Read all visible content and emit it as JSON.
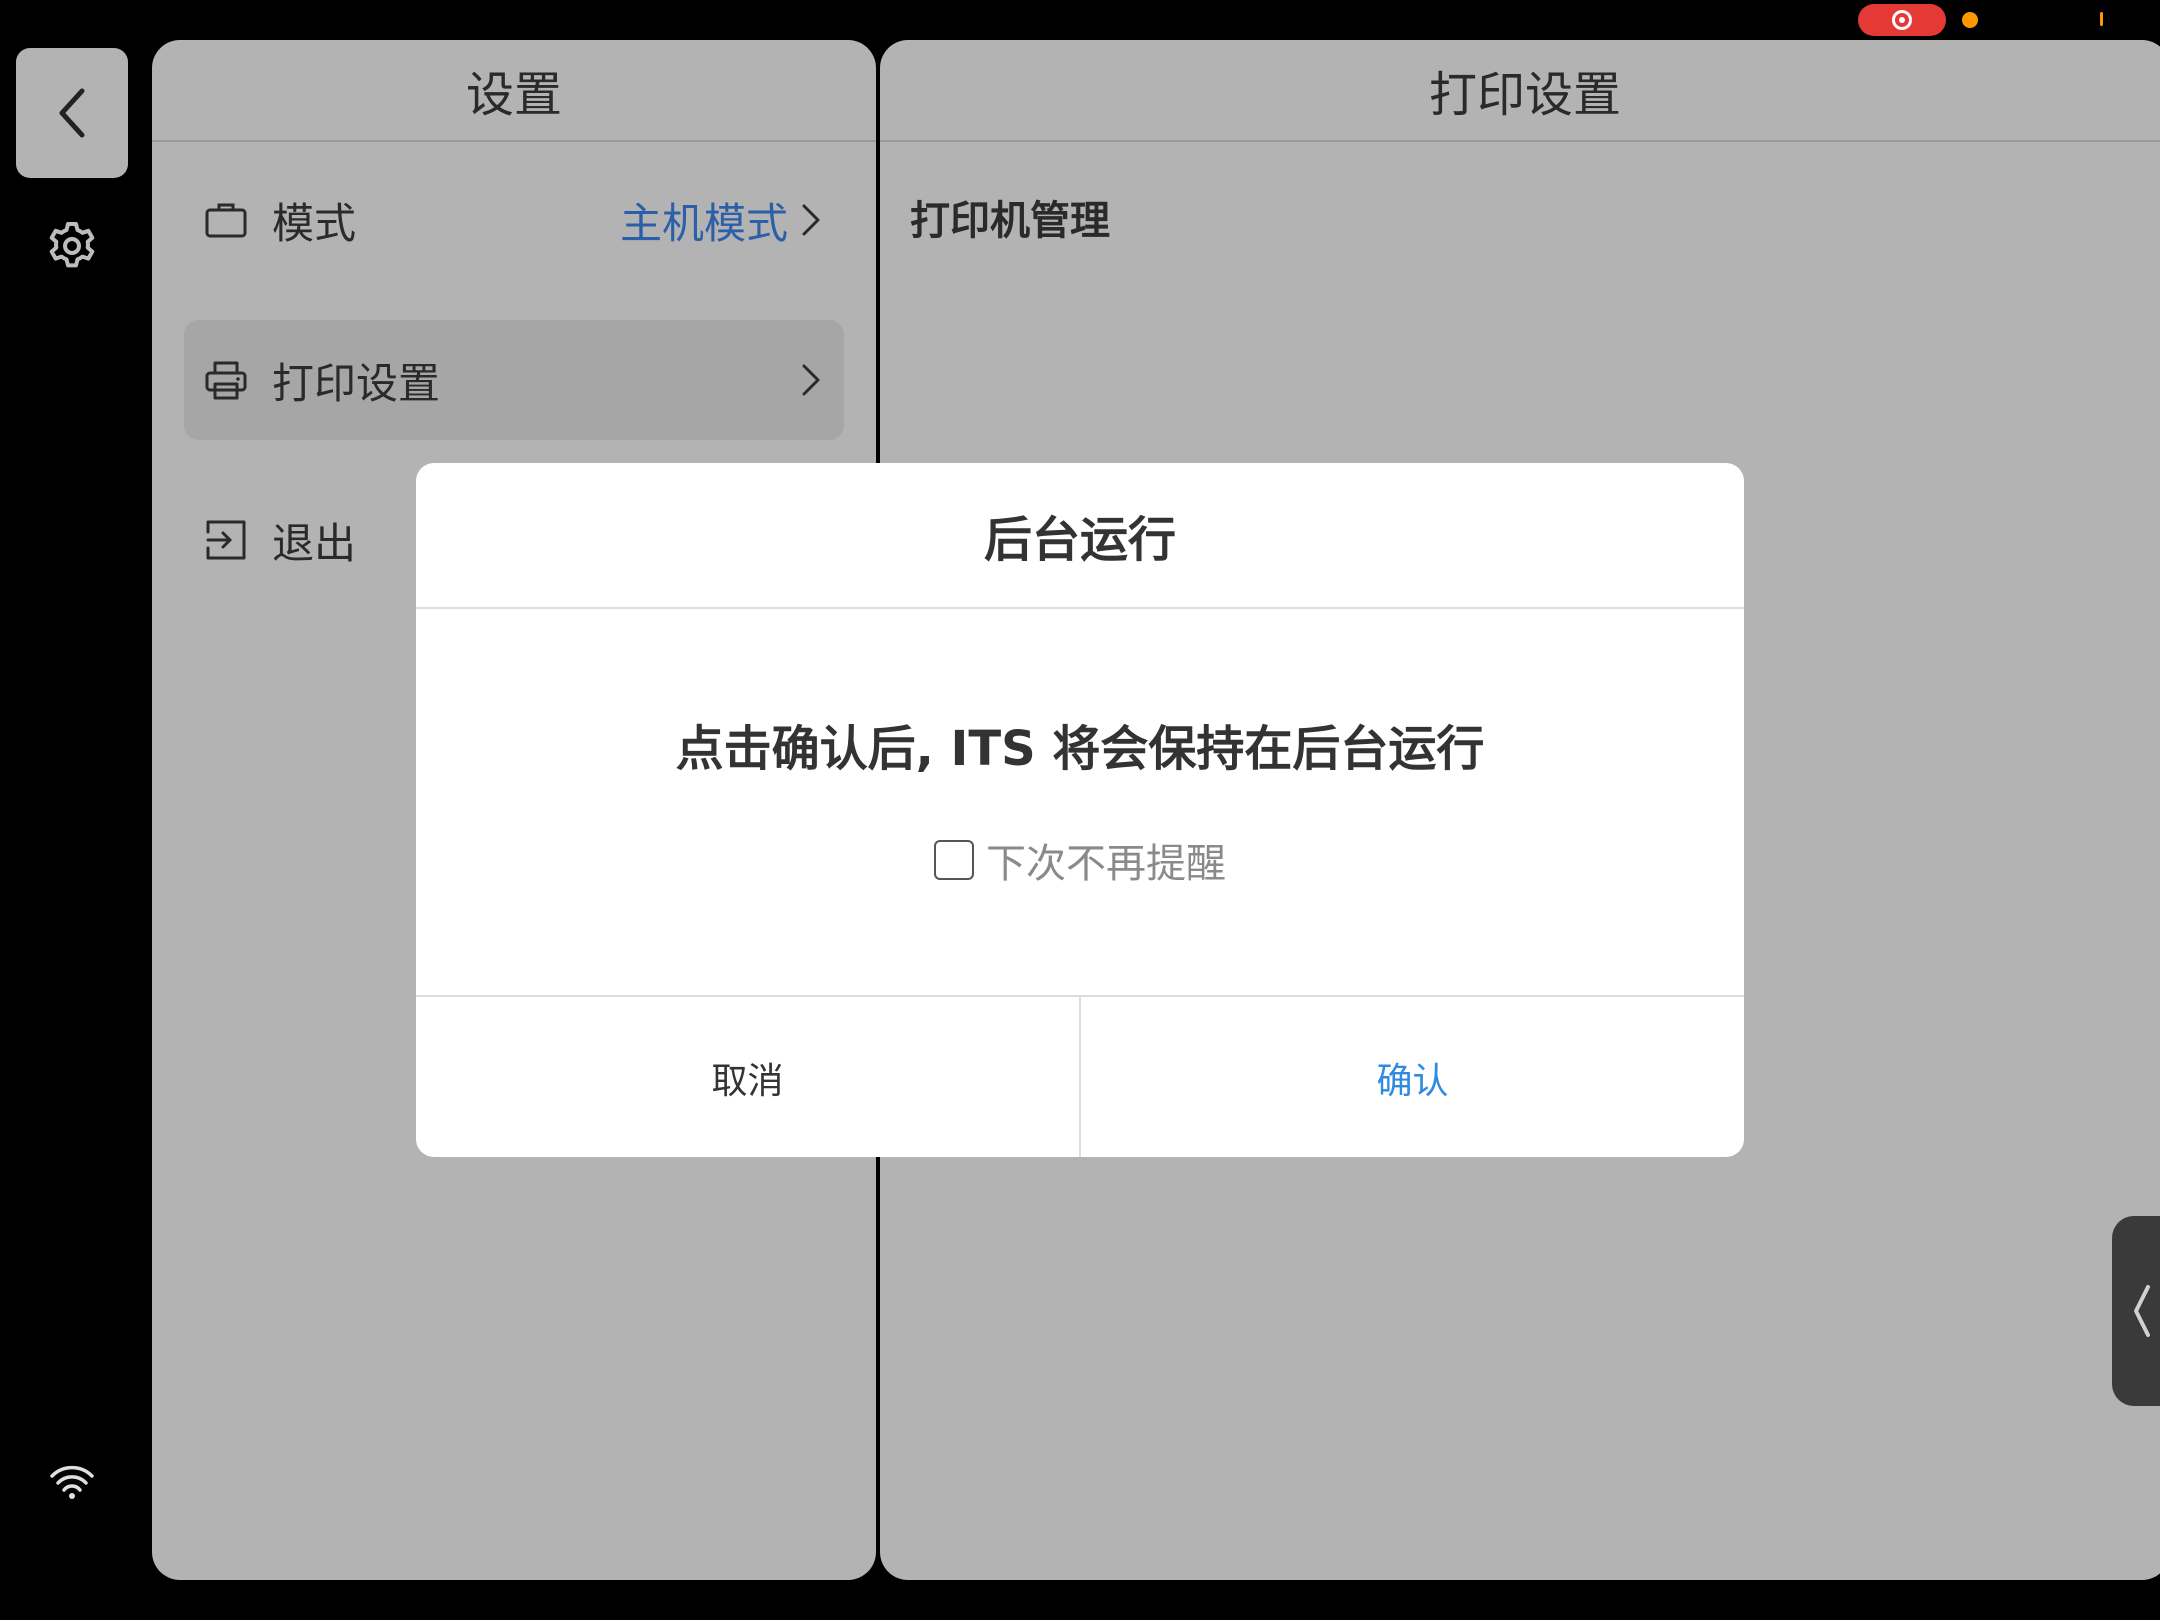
{
  "left_rail": {
    "back_icon": "chevron-left-icon",
    "settings_icon": "gear-icon",
    "wifi_icon": "wifi-icon"
  },
  "settings_panel": {
    "title": "设置",
    "items": [
      {
        "label": "模式",
        "value": "主机模式",
        "icon": "briefcase-icon"
      },
      {
        "label": "打印设置",
        "value": "",
        "icon": "printer-icon"
      },
      {
        "label": "退出",
        "value": "",
        "icon": "exit-icon"
      }
    ]
  },
  "print_panel": {
    "title": "打印设置",
    "section_title": "打印机管理"
  },
  "dialog": {
    "title": "后台运行",
    "message": "点击确认后, ITS 将会保持在后台运行",
    "checkbox_label": "下次不再提醒",
    "cancel_label": "取消",
    "confirm_label": "确认"
  },
  "colors": {
    "accent_blue": "#2f8be0",
    "value_blue": "#2b5fa8",
    "record_red": "#e53935",
    "status_orange": "#ff9800"
  }
}
